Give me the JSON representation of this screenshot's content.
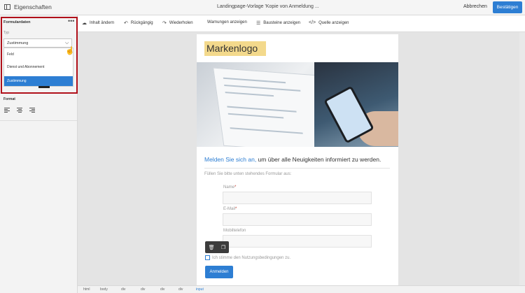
{
  "topbar": {
    "panel_title": "Eigenschaften",
    "document_title": "Landingpage-Vorlage 'Kopie von Anmeldung ...",
    "cancel_label": "Abbrechen",
    "confirm_label": "Bestätigen"
  },
  "left_panel": {
    "section_title": "Formulardaten",
    "more_icon": "more-horizontal-icon",
    "type_label": "Typ",
    "select_value": "Zustimmung",
    "dropdown_options": [
      "Feld",
      "Dienst und Abonnement",
      "Zustimmung"
    ],
    "selected_option_index": 2,
    "format_label": "Format",
    "align_icons": [
      "align-left-icon",
      "align-center-icon",
      "align-right-icon"
    ]
  },
  "toolbar": {
    "items": [
      {
        "label": "Inhalt ändern",
        "icon": "cloud-upload-icon"
      },
      {
        "label": "Rückgängig",
        "icon": "undo-icon"
      },
      {
        "label": "Wiederholen",
        "icon": "redo-icon"
      },
      {
        "label": "Warnungen anzeigen",
        "icon": ""
      },
      {
        "label": "Bausteine anzeigen",
        "icon": "blocks-icon"
      },
      {
        "label": "Quelle anzeigen",
        "icon": "code-icon"
      }
    ]
  },
  "email": {
    "logo": "Markenlogo",
    "headline_link": "Melden Sie sich an,",
    "headline_rest": " um über alle Neuigkeiten informiert zu werden.",
    "intro": "Füllen Sie bitte unten stehendes Formular aus:",
    "fields": [
      {
        "label": "Name",
        "required": "*"
      },
      {
        "label": "E-Mail",
        "required": "*"
      },
      {
        "label": "Mobiltelefon",
        "required": ""
      }
    ],
    "consent_text": "Ich stimme den Nutzungsbedingungen zu.",
    "submit_label": "Anmelden"
  },
  "breadcrumb": [
    "html",
    "body",
    "div",
    "div",
    "div",
    "div",
    "input"
  ],
  "colors": {
    "accent": "#2d7ed3",
    "highlight_border": "#b0101a",
    "logo_bg": "#f3d98c"
  }
}
